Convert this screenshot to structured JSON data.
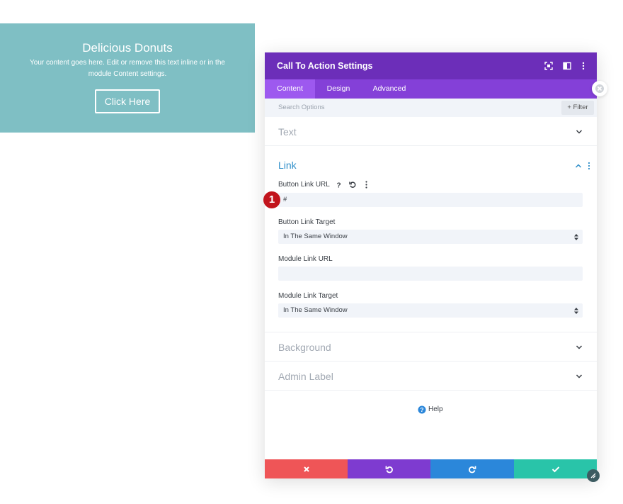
{
  "cta": {
    "title": "Delicious Donuts",
    "body": "Your content goes here. Edit or remove this text inline or in the module Content settings.",
    "button_label": "Click Here"
  },
  "modal": {
    "title": "Call To Action Settings",
    "tabs": [
      {
        "label": "Content",
        "active": true
      },
      {
        "label": "Design",
        "active": false
      },
      {
        "label": "Advanced",
        "active": false
      }
    ],
    "search_placeholder": "Search Options",
    "filter_label": "+ Filter",
    "sections": {
      "text": "Text",
      "link": "Link",
      "background": "Background",
      "admin_label": "Admin Label"
    },
    "fields": {
      "button_link_url_label": "Button Link URL",
      "button_link_url_value": "#",
      "button_link_target_label": "Button Link Target",
      "button_link_target_value": "In The Same Window",
      "module_link_url_label": "Module Link URL",
      "module_link_url_value": "",
      "module_link_target_label": "Module Link Target",
      "module_link_target_value": "In The Same Window"
    },
    "help_label": "Help"
  },
  "badge_number": "1",
  "colors": {
    "cta_bg": "#7fbfc4",
    "header": "#6c2eb9",
    "tabs": "#8440d8",
    "tab_active": "#9d59ef",
    "link_accent": "#2e8ec9",
    "cancel": "#ef5557",
    "undo": "#7e3bd0",
    "redo": "#2b87da",
    "save": "#29c4a9",
    "badge": "#c2141c"
  }
}
